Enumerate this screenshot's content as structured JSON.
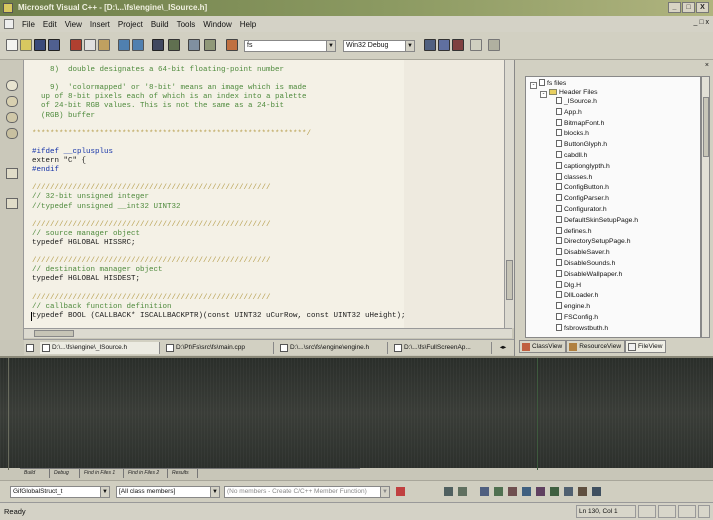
{
  "window": {
    "title": "Microsoft Visual C++ - [D:\\...\\fs\\engine\\_ISource.h]",
    "controls": [
      "_",
      "□",
      "X"
    ],
    "mdi_controls": "_ □ x"
  },
  "menu": [
    "File",
    "Edit",
    "View",
    "Insert",
    "Project",
    "Build",
    "Tools",
    "Window",
    "Help"
  ],
  "toolbar": {
    "project_combo": "fs",
    "config_combo": "Win32 Debug"
  },
  "editor": {
    "lines": [
      {
        "cls": "cm",
        "text": "    8)  double designates a 64-bit floating-point number"
      },
      {
        "cls": "cm",
        "text": ""
      },
      {
        "cls": "cm",
        "text": "    9)  'colormapped' or '8-bit' means an image which is made"
      },
      {
        "cls": "cm",
        "text": "  up of 8-bit pixels each of which is an index into a palette"
      },
      {
        "cls": "cm",
        "text": "  of 24-bit RGB values. This is not the same as a 24-bit"
      },
      {
        "cls": "cm",
        "text": "  (RGB) buffer"
      },
      {
        "cls": "cm",
        "text": ""
      },
      {
        "cls": "hl",
        "text": "*************************************************************/"
      },
      {
        "cls": "",
        "text": ""
      },
      {
        "cls": "kw",
        "text": "#ifdef __cplusplus"
      },
      {
        "cls": "",
        "text": "extern \"C\" {"
      },
      {
        "cls": "kw",
        "text": "#endif"
      },
      {
        "cls": "",
        "text": ""
      },
      {
        "cls": "hl",
        "text": "/////////////////////////////////////////////////////"
      },
      {
        "cls": "cm",
        "text": "// 32-bit unsigned integer"
      },
      {
        "cls": "cm",
        "text": "//typedef unsigned __int32 UINT32"
      },
      {
        "cls": "",
        "text": ""
      },
      {
        "cls": "hl",
        "text": "/////////////////////////////////////////////////////"
      },
      {
        "cls": "cm",
        "text": "// source manager object"
      },
      {
        "cls": "",
        "text": "typedef HGLOBAL HISSRC;"
      },
      {
        "cls": "",
        "text": ""
      },
      {
        "cls": "hl",
        "text": "/////////////////////////////////////////////////////"
      },
      {
        "cls": "cm",
        "text": "// destination manager object"
      },
      {
        "cls": "",
        "text": "typedef HGLOBAL HISDEST;"
      },
      {
        "cls": "",
        "text": ""
      },
      {
        "cls": "hl",
        "text": "/////////////////////////////////////////////////////"
      },
      {
        "cls": "cm",
        "text": "// callback function definition"
      },
      {
        "cls": "",
        "text": "typedef BOOL (CALLBACK* ISCALLBACKPTR)(const UINT32 uCurRow, const UINT32 uHeight);"
      }
    ]
  },
  "editor_tabs": [
    "D:\\...\\fs\\engine\\_ISource.h",
    "D:\\Pt\\Fs\\src\\fs\\main.cpp",
    "D:\\...\\src\\fs\\engine\\engine.h",
    "D:\\...\\fs\\FullScreenAp..."
  ],
  "tree": {
    "root": "fs files",
    "folder": "Header Files",
    "files": [
      "_ISource.h",
      "App.h",
      "BitmapFont.h",
      "blocks.h",
      "ButtonGlyph.h",
      "cabdll.h",
      "captionglypth.h",
      "classes.h",
      "ConfigButton.h",
      "ConfigParser.h",
      "Configurator.h",
      "DefaultSkinSetupPage.h",
      "defines.h",
      "DirectorySetupPage.h",
      "DisableSaver.h",
      "DisableSounds.h",
      "DisableWallpaper.h",
      "Dlg.H",
      "DllLoader.h",
      "engine.h",
      "FSConfig.h",
      "fsbrowstbuth.h"
    ]
  },
  "panel_tabs": [
    "ClassView",
    "ResourceView",
    "FileView"
  ],
  "output_tabs": [
    "Build",
    "Debug",
    "Find in Files 1",
    "Find in Files 2",
    "Results"
  ],
  "wizard": {
    "class_combo": "GifGlobalStruct_t",
    "filter_combo": "[All class members]",
    "member_combo": "(No members - Create C/C++ Member Function)"
  },
  "status": {
    "ready": "Ready",
    "position": "Ln 130, Col 1"
  },
  "colors": {
    "title_gradient_start": "#6f7f4a",
    "editor_bg": "#f4f1e6",
    "keyword": "#1432a8",
    "comment": "#4e8a3c",
    "output_bg": "#2c302c"
  }
}
